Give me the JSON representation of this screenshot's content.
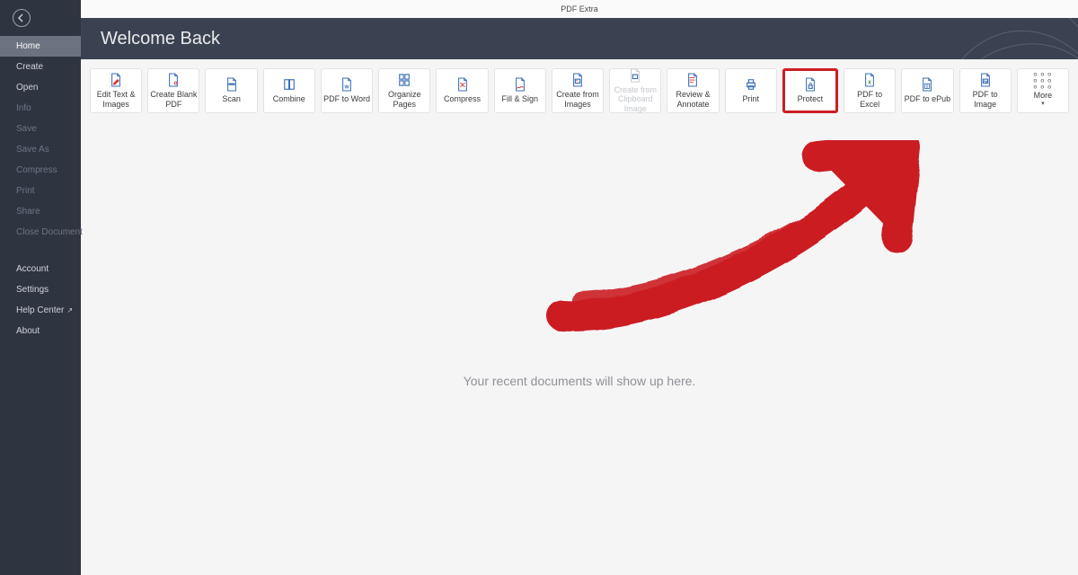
{
  "app_title": "PDF Extra",
  "welcome": "Welcome Back",
  "sidebar": {
    "items": [
      {
        "label": "Home",
        "selected": true,
        "dim": false
      },
      {
        "label": "Create",
        "selected": false,
        "dim": false
      },
      {
        "label": "Open",
        "selected": false,
        "dim": false
      },
      {
        "label": "Info",
        "selected": false,
        "dim": true
      },
      {
        "label": "Save",
        "selected": false,
        "dim": true
      },
      {
        "label": "Save As",
        "selected": false,
        "dim": true
      },
      {
        "label": "Compress",
        "selected": false,
        "dim": true
      },
      {
        "label": "Print",
        "selected": false,
        "dim": true
      },
      {
        "label": "Share",
        "selected": false,
        "dim": true
      },
      {
        "label": "Close Document",
        "selected": false,
        "dim": true
      }
    ],
    "footer": [
      {
        "label": "Account"
      },
      {
        "label": "Settings"
      },
      {
        "label": "Help Center",
        "external": true
      },
      {
        "label": "About"
      }
    ]
  },
  "tools": [
    {
      "label": "Edit Text & Images",
      "icon": "edit"
    },
    {
      "label": "Create Blank PDF",
      "icon": "blank"
    },
    {
      "label": "Scan",
      "icon": "scan"
    },
    {
      "label": "Combine",
      "icon": "combine"
    },
    {
      "label": "PDF to Word",
      "icon": "toword"
    },
    {
      "label": "Organize Pages",
      "icon": "organize"
    },
    {
      "label": "Compress",
      "icon": "compress"
    },
    {
      "label": "Fill & Sign",
      "icon": "sign"
    },
    {
      "label": "Create from Images",
      "icon": "fromimg"
    },
    {
      "label": "Create from Clipboard Image",
      "icon": "fromclip",
      "disabled": true
    },
    {
      "label": "Review & Annotate",
      "icon": "annotate"
    },
    {
      "label": "Print",
      "icon": "print"
    },
    {
      "label": "Protect",
      "icon": "protect",
      "highlight": true
    },
    {
      "label": "PDF to Excel",
      "icon": "toexcel"
    },
    {
      "label": "PDF to ePub",
      "icon": "toepub"
    },
    {
      "label": "PDF to Image",
      "icon": "toimage"
    },
    {
      "label": "More",
      "icon": "more"
    }
  ],
  "empty_state": "Your recent documents will show up here.",
  "annotation": {
    "color": "#cb1f24"
  }
}
